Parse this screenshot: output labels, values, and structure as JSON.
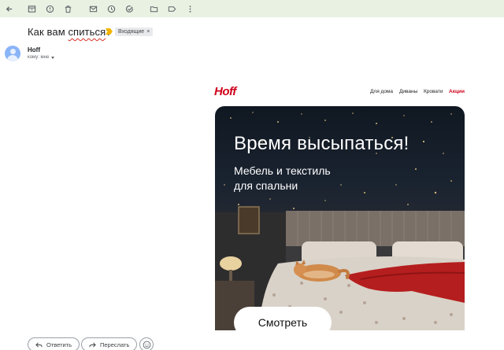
{
  "toolbar": {
    "icons": [
      "back-arrow-icon",
      "archive-icon",
      "report-spam-icon",
      "delete-icon",
      "mark-unread-icon",
      "snooze-icon",
      "add-task-icon",
      "move-to-icon",
      "label-icon",
      "more-icon"
    ]
  },
  "message": {
    "subject": "Как вам спиться?",
    "subject_before_error": "Как вам ",
    "subject_misspelled": "спиться",
    "subject_after_error": "?",
    "label": "Входящие",
    "label_close": "×",
    "sender_name": "Hoff",
    "recipient": "кому: мне"
  },
  "email": {
    "logo": "Hoff",
    "nav": [
      "Для дома",
      "Диваны",
      "Кровати",
      "Акции"
    ],
    "hero_title": "Время высыпаться!",
    "hero_subtitle_line1": "Мебель и текстиль",
    "hero_subtitle_line2": "для спальни",
    "cta": "Смотреть"
  },
  "actions": {
    "reply": "Ответить",
    "forward": "Переслать"
  },
  "colors": {
    "toolbar_bg": "#e9f1e3",
    "brand_red": "#d0021b",
    "avatar": "#8ab4f8"
  }
}
